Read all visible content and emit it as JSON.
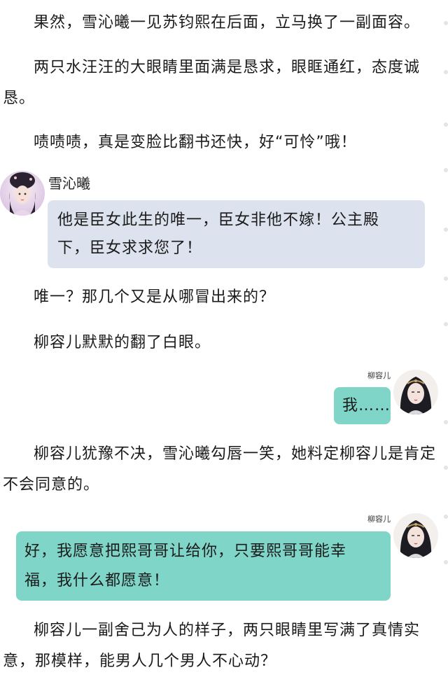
{
  "paragraphs": [
    "果然，雪沁曦一见苏钧熙在后面，立马换了一副面容。",
    "两只水汪汪的大眼睛里面满是恳求，眼眶通红，态度诚恳。",
    "啧啧啧，真是变脸比翻书还快，好“可怜”哦！",
    "唯一？那几个又是从哪冒出来的？",
    "柳容儿默默的翻了白眼。",
    "柳容儿犹豫不决，雪沁曦勾唇一笑，她料定柳容儿是肯定不会同意的。",
    "柳容儿一副舍己为人的样子，两只眼睛里写满了真情实意，那模样，能男人几个男人不心动？"
  ],
  "chat": [
    {
      "speaker": "雪沁曦",
      "side": "left",
      "text": "他是臣女此生的唯一，臣女非他不嫁！公主殿下，臣女求求您了！",
      "bubble_color": "#dde3ee"
    },
    {
      "speaker": "柳容儿",
      "side": "right",
      "text": "我……",
      "bubble_color": "#7fd6c8"
    },
    {
      "speaker": "柳容儿",
      "side": "right",
      "text": "好，我愿意把熙哥哥让给你，只要熙哥哥能幸福，我什么都愿意！",
      "bubble_color": "#7fd6c8"
    }
  ]
}
